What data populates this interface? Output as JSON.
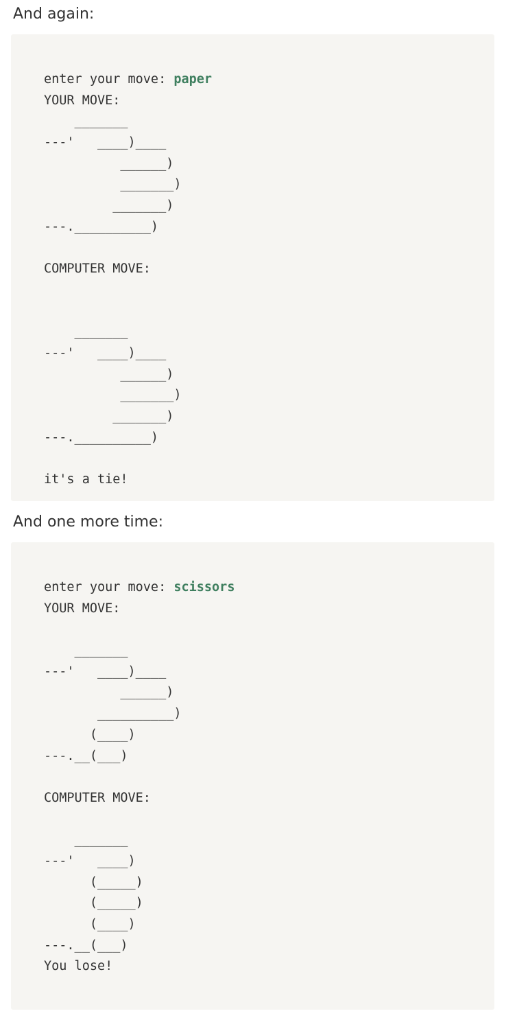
{
  "captions": {
    "first": "And again:",
    "second": "And one more time:"
  },
  "colors": {
    "code_background": "#f6f5f2",
    "user_input": "#3f7f5f",
    "text": "#333333"
  },
  "block1": {
    "prompt": "enter your move: ",
    "input": "paper",
    "lines": [
      "YOUR MOVE:",
      "    _______",
      "---'   ____)____",
      "          ______)",
      "          _______)",
      "         _______)",
      "---.__________)",
      "",
      "COMPUTER MOVE:",
      "",
      "",
      "    _______",
      "---'   ____)____",
      "          ______)",
      "          _______)",
      "         _______)",
      "---.__________)",
      "",
      "it's a tie!"
    ]
  },
  "block2": {
    "prompt": "enter your move: ",
    "input": "scissors",
    "lines": [
      "YOUR MOVE:",
      "",
      "    _______",
      "---'   ____)____",
      "          ______)",
      "       __________)",
      "      (____)",
      "---.__(___)",
      "",
      "COMPUTER MOVE:",
      "",
      "    _______",
      "---'   ____)",
      "      (_____)",
      "      (_____)",
      "      (____)",
      "---.__(___)",
      "You lose!"
    ]
  }
}
